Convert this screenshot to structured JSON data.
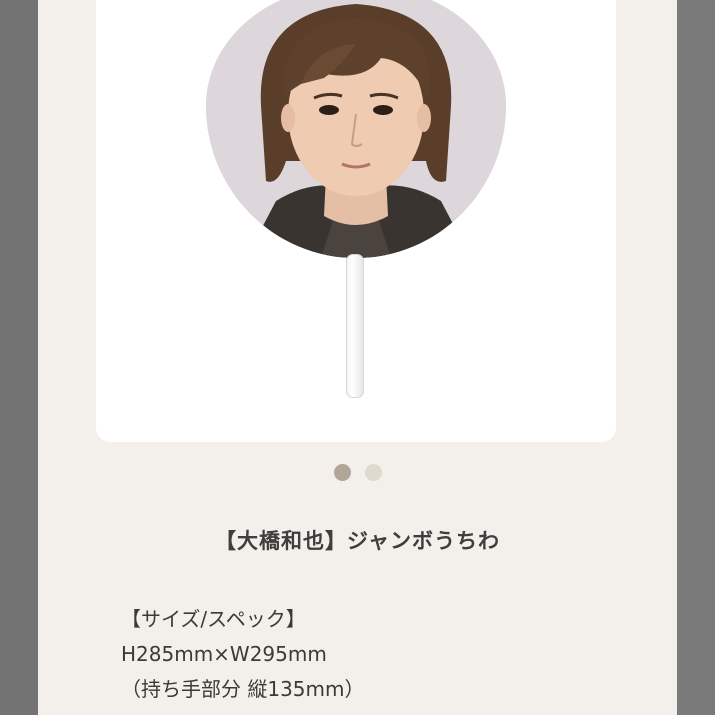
{
  "product": {
    "title": "【大橋和也】ジャンボうちわ",
    "image_alt": "jumbo uchiwa fan with portrait photo",
    "carousel": {
      "total": 2,
      "active": 1
    }
  },
  "spec": {
    "heading": "【サイズ/スペック】",
    "size": "H285mm×W295mm",
    "handle": "（持ち手部分 縦135mm）"
  },
  "colors": {
    "page_background": "#f3efea",
    "card_background": "#ffffff",
    "dot_active": "#b1a697",
    "dot_inactive": "#e0d9cf"
  }
}
